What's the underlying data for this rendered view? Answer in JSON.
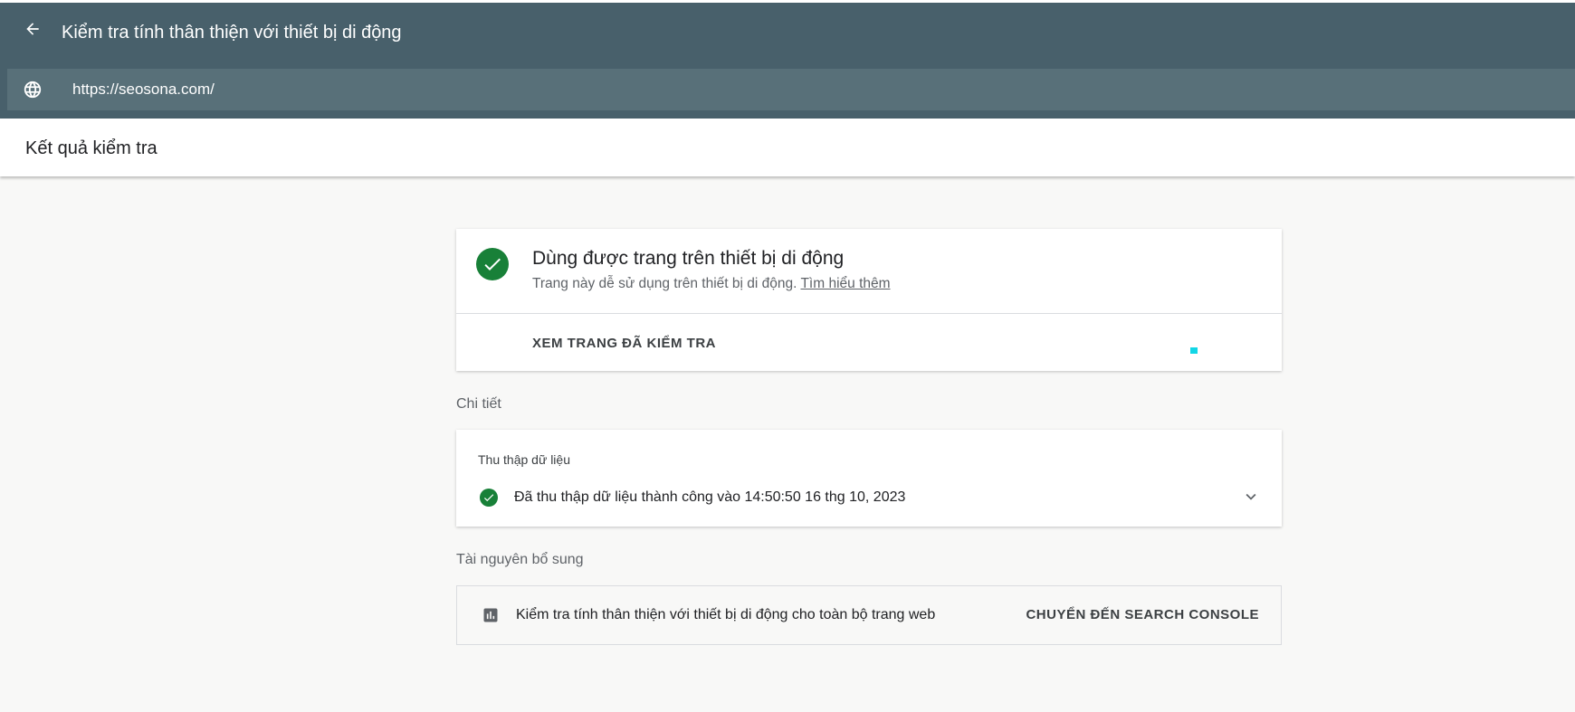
{
  "header": {
    "title": "Kiểm tra tính thân thiện với thiết bị di động",
    "back_icon": "arrow-back-icon",
    "url": "https://seosona.com/",
    "url_icon": "globe-icon"
  },
  "results_header": {
    "title": "Kết quả kiểm tra"
  },
  "result_card": {
    "status_icon": "check-circle-icon",
    "title": "Dùng được trang trên thiết bị di động",
    "description": "Trang này dễ sử dụng trên thiết bị di động.",
    "learn_more": "Tìm hiểu thêm",
    "view_tested_page": "XEM TRANG ĐÃ KIỂM TRA"
  },
  "details": {
    "section_label": "Chi tiết",
    "crawl_label": "Thu thập dữ liệu",
    "crawl_status": "Đã thu thập dữ liệu thành công vào 14:50:50 16 thg 10, 2023",
    "expand_icon": "chevron-down-icon"
  },
  "resources": {
    "section_label": "Tài nguyên bổ sung",
    "icon": "bar-chart-icon",
    "text": "Kiểm tra tính thân thiện với thiết bị di động cho toàn bộ trang web",
    "link": "CHUYỂN ĐẾN SEARCH CONSOLE"
  },
  "colors": {
    "header_bg": "#48606b",
    "url_bar_bg": "#587079",
    "success_green": "#188038",
    "page_bg": "#f8f8f7"
  }
}
